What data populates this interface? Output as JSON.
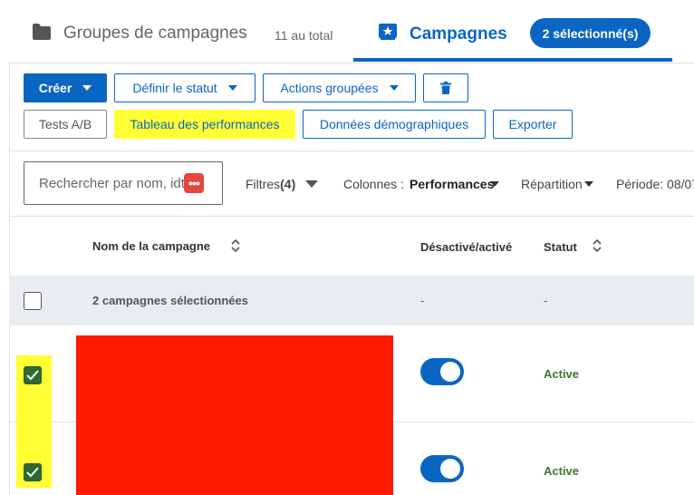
{
  "tabs": {
    "groups_label": "Groupes de campagnes",
    "groups_count": "11 au total",
    "campaigns_label": "Campagnes",
    "selected_badge": "2 sélectionné(s)"
  },
  "toolbar": {
    "create": "Créer",
    "set_status": "Définir le statut",
    "bulk_actions": "Actions groupées",
    "ab_tests": "Tests A/B",
    "performance_chart": "Tableau des performances",
    "demographics": "Données démographiques",
    "export": "Exporter"
  },
  "filters": {
    "search_placeholder": "Rechercher par nom, id",
    "search_suffix": "t",
    "filters_label": "Filtres",
    "filters_count": "(4)",
    "columns_label": "Colonnes :",
    "columns_value": "Performances",
    "breakdown_label": "Répartition",
    "period_label": "Période: 08/07"
  },
  "table": {
    "headers": {
      "name": "Nom de la campagne",
      "toggle": "Désactivé/activé",
      "status": "Statut"
    },
    "summary": {
      "label": "2 campagnes sélectionnées",
      "toggle": "-",
      "status": "-"
    },
    "rows": [
      {
        "checked": true,
        "enabled": true,
        "status": "Active"
      },
      {
        "checked": true,
        "enabled": true,
        "status": "Active"
      }
    ]
  },
  "colors": {
    "accent": "#0a66c2",
    "highlight": "#ffff33",
    "redaction": "#ff1a00",
    "active_status": "#3d7a2e"
  }
}
